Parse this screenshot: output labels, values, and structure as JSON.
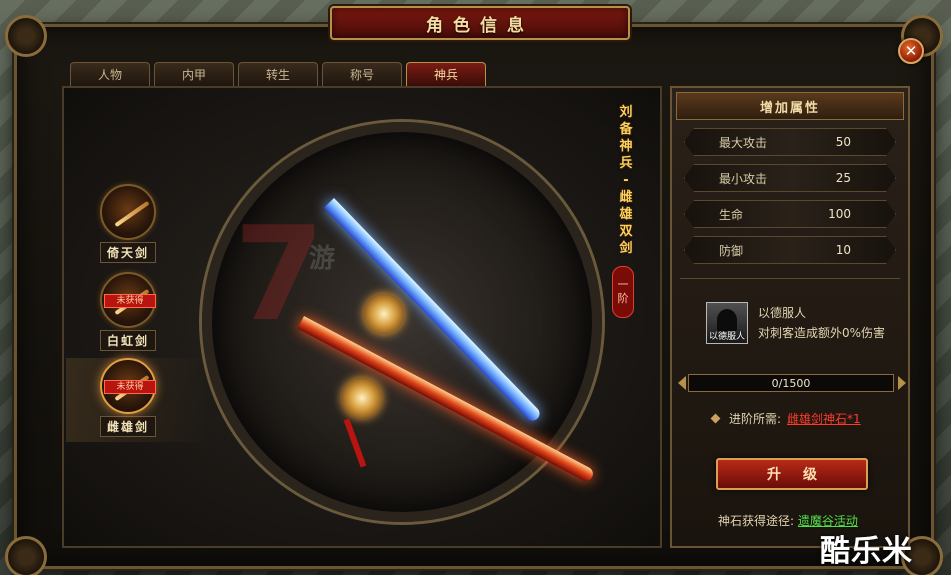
{
  "window": {
    "title": "角色信息"
  },
  "close_glyph": "✕",
  "tabs": [
    {
      "label": "人物",
      "active": false
    },
    {
      "label": "内甲",
      "active": false
    },
    {
      "label": "转生",
      "active": false
    },
    {
      "label": "称号",
      "active": false
    },
    {
      "label": "神兵",
      "active": true
    }
  ],
  "weapons_list": [
    {
      "label": "倚天剑",
      "badge": ""
    },
    {
      "label": "白虹剑",
      "badge": "未获得"
    },
    {
      "label": "雌雄剑",
      "badge": "未获得",
      "selected": true
    }
  ],
  "showcase": {
    "title_chars": [
      "刘",
      "备",
      "神",
      "兵",
      "-",
      "雌",
      "雄",
      "双",
      "剑"
    ],
    "rank": [
      "一",
      "阶"
    ],
    "watermark": "游"
  },
  "attributes": {
    "header": "增加属性",
    "stats": [
      {
        "name": "最大攻击",
        "value": "50"
      },
      {
        "name": "最小攻击",
        "value": "25"
      },
      {
        "name": "生命",
        "value": "100"
      },
      {
        "name": "防御",
        "value": "10"
      }
    ]
  },
  "skill": {
    "icon_caption": "以德服人",
    "name": "以德服人",
    "description": "对刺客造成额外0%伤害"
  },
  "progress": {
    "text": "0/1500",
    "fraction": 0
  },
  "requirement": {
    "label": "进阶所需:",
    "item": "雌雄剑神石*1"
  },
  "upgrade_label": "升级",
  "source": {
    "label": "神石获得途径:",
    "link": "遗魔谷活动"
  },
  "site_watermark": "酷乐米"
}
